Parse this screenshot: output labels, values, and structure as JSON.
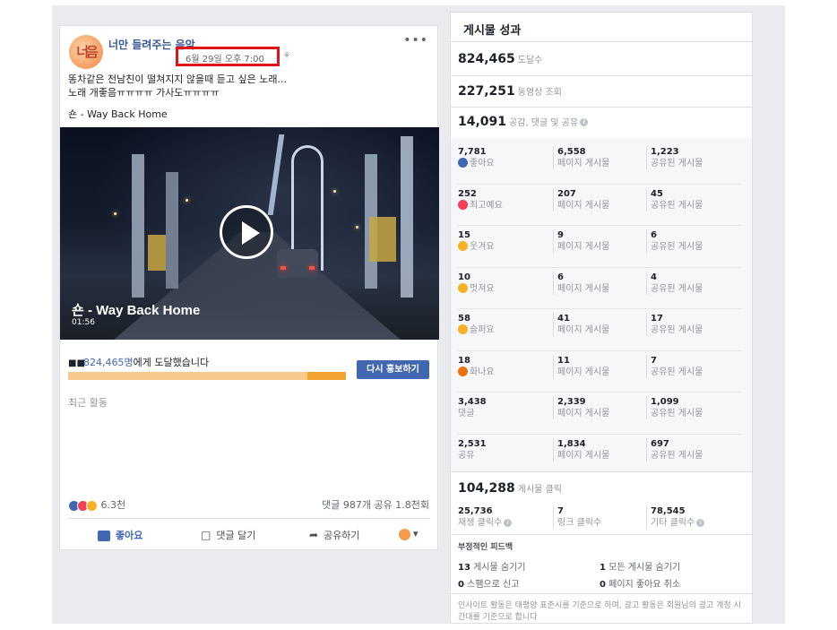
{
  "post": {
    "page_name": "너만 들려주는 음악",
    "avatar_text": "너음",
    "timestamp": "6월 29일 오후 7:00",
    "privacy_glyph": "· ⚘",
    "more_glyph": "•••",
    "text_line1": "똥차같은 전남친이 떨쳐지지 않을때 듣고 싶은 노래...",
    "text_line2": "노래 개좋음ㅠㅠㅠㅠ 가사도ㅠㅠㅠㅠ",
    "song": "숀 - Way Back Home",
    "video_title": "숀 - Way Back Home",
    "video_duration": "01:56",
    "reach_number": "824,465명",
    "reach_suffix": "에게 도달했습니다",
    "reach_progress": 0.86,
    "boost_label": "다시 홍보하기",
    "recent_label": "최근 활동",
    "reactions_count": "6.3천",
    "comments_shares": "댓글 987개  공유 1.8천회",
    "like_label": "좋아요",
    "comment_label": "댓글 달기",
    "share_label": "공유하기",
    "colors": {
      "link": "#385898",
      "button": "#4267b2",
      "bar_dark": "#f0a32e",
      "bar_light": "#f7c98d"
    }
  },
  "insights": {
    "title": "게시물 성과",
    "reach": {
      "value": "824,465",
      "label": "도달수"
    },
    "views": {
      "value": "227,251",
      "label": "동영상 조회"
    },
    "engagement": {
      "value": "14,091",
      "label": "공감, 댓글 및 공유"
    },
    "rows": [
      {
        "total": "7,781",
        "label": "좋아요",
        "emoji": "like",
        "page": "6,558",
        "page_label": "페이지 게시물",
        "shared": "1,223",
        "shared_label": "공유된 게시물"
      },
      {
        "total": "252",
        "label": "최고예요",
        "emoji": "love",
        "page": "207",
        "page_label": "페이지 게시물",
        "shared": "45",
        "shared_label": "공유된 게시물"
      },
      {
        "total": "15",
        "label": "웃겨요",
        "emoji": "haha",
        "page": "9",
        "page_label": "페이지 게시물",
        "shared": "6",
        "shared_label": "공유된 게시물"
      },
      {
        "total": "10",
        "label": "멋져요",
        "emoji": "wow",
        "page": "6",
        "page_label": "페이지 게시물",
        "shared": "4",
        "shared_label": "공유된 게시물"
      },
      {
        "total": "58",
        "label": "슬퍼요",
        "emoji": "sad",
        "page": "41",
        "page_label": "페이지 게시물",
        "shared": "17",
        "shared_label": "공유된 게시물"
      },
      {
        "total": "18",
        "label": "화나요",
        "emoji": "angry",
        "page": "11",
        "page_label": "페이지 게시물",
        "shared": "7",
        "shared_label": "공유된 게시물"
      },
      {
        "total": "3,438",
        "label": "댓글",
        "emoji": "",
        "page": "2,339",
        "page_label": "페이지 게시물",
        "shared": "1,099",
        "shared_label": "공유된 게시물"
      },
      {
        "total": "2,531",
        "label": "공유",
        "emoji": "",
        "page": "1,834",
        "page_label": "페이지 게시물",
        "shared": "697",
        "shared_label": "공유된 게시물"
      }
    ],
    "clicks": {
      "value": "104,288",
      "label": "게시물 클릭"
    },
    "click_breakdown": [
      {
        "value": "25,736",
        "label": "재생 클릭수"
      },
      {
        "value": "7",
        "label": "링크 클릭수"
      },
      {
        "value": "78,545",
        "label": "기타 클릭수"
      }
    ],
    "negative_title": "부정적인 피드백",
    "negative": [
      {
        "value": "13",
        "label": "게시물 숨기기"
      },
      {
        "value": "1",
        "label": "모든 게시물 숨기기"
      },
      {
        "value": "0",
        "label": "스팸으로 신고"
      },
      {
        "value": "0",
        "label": "페이지 좋아요 취소"
      }
    ],
    "footnote": "인사이트 활동은 태평양 표준시를 기준으로 하며, 광고 활동은 회원님의 광고 계정 시간대를 기준으로 합니다",
    "info_glyph": "i",
    "emoji_colors": {
      "like": "#4267b2",
      "love": "#f33e58",
      "haha": "#f7b125",
      "wow": "#f7b125",
      "sad": "#f7b125",
      "angry": "#e9710f"
    }
  }
}
